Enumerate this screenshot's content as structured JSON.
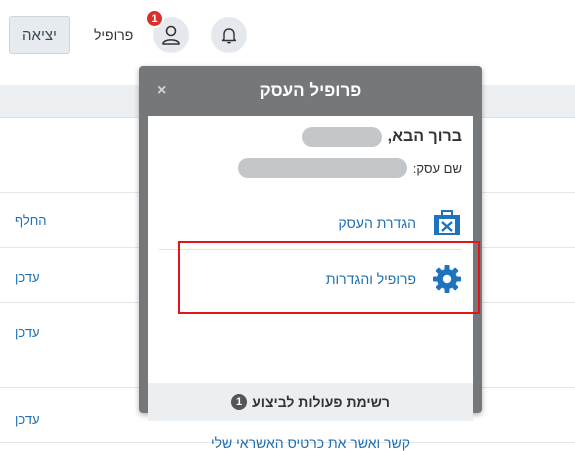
{
  "topbar": {
    "logout_label": "יציאה",
    "profile_label": "פרופיל",
    "notification_count": "1"
  },
  "background": {
    "row_links": [
      "החלף",
      "עדכן",
      "עדכן",
      "עדכן"
    ]
  },
  "popup": {
    "title": "פרופיל העסק",
    "close_label": "×",
    "greeting": "ברוך הבא,",
    "business_name_label": "שם עסק:",
    "menu": [
      {
        "label": "הגדרת העסק",
        "icon": "business-settings-icon"
      },
      {
        "label": "פרופיל והגדרות",
        "icon": "gear-icon"
      }
    ],
    "tasks_heading": "רשימת פעולות לביצוע",
    "tasks_count": "1",
    "task_link": "קשר ואשר את כרטיס האשראי שלי"
  },
  "colors": {
    "link": "#1f6fb2",
    "popup_header": "#74787b",
    "badge": "#d9302c",
    "highlight": "#e4141b",
    "gear": "#1e73be"
  }
}
